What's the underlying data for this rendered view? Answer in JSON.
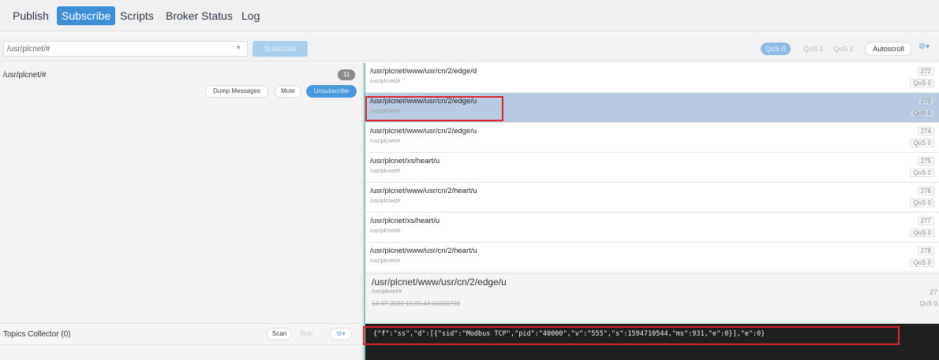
{
  "nav": {
    "tabs": [
      {
        "label": "Publish",
        "active": false
      },
      {
        "label": "Subscribe",
        "active": true
      },
      {
        "label": "Scripts",
        "active": false
      },
      {
        "label": "Broker Status",
        "active": false
      },
      {
        "label": "Log",
        "active": false
      }
    ]
  },
  "subscribe_bar": {
    "topic_value": "/usr/plcnet/#",
    "subscribe_label": "Subscribe",
    "qos_options": [
      {
        "label": "QoS 0",
        "selected": true
      },
      {
        "label": "QoS 1",
        "selected": false
      },
      {
        "label": "QoS 2",
        "selected": false
      }
    ],
    "autoscroll_label": "Autoscroll",
    "settings_glyph": "⚙▾"
  },
  "subscriptions": {
    "items": [
      {
        "topic": "/usr/plcnet/#",
        "count": "11"
      }
    ],
    "dump_label": "Dump Messages",
    "mute_label": "Mute",
    "unsubscribe_label": "Unsubscribe"
  },
  "topics_collector": {
    "label": "Topics Collector (0)",
    "scan_label": "Scan",
    "stop_label": "Stop",
    "settings_glyph": "⚙▾"
  },
  "messages": [
    {
      "topic": "/usr/plcnet/www/usr/cn/2/edge/d",
      "subscription": "/usr/plcnet/#",
      "num": "272",
      "qos": "QoS 0",
      "selected": false
    },
    {
      "topic": "/usr/plcnet/www/usr/cn/2/edge/u",
      "subscription": "/usr/plcnet/#",
      "num": "273",
      "qos": "QoS 0",
      "selected": true
    },
    {
      "topic": "/usr/plcnet/www/usr/cn/2/edge/u",
      "subscription": "/usr/plcnet/#",
      "num": "274",
      "qos": "QoS 0",
      "selected": false
    },
    {
      "topic": "/usr/plcnet/xs/heart/u",
      "subscription": "/usr/plcnet/#",
      "num": "275",
      "qos": "QoS 0",
      "selected": false
    },
    {
      "topic": "/usr/plcnet/www/usr/cn/2/heart/u",
      "subscription": "/usr/plcnet/#",
      "num": "276",
      "qos": "QoS 0",
      "selected": false
    },
    {
      "topic": "/usr/plcnet/xs/heart/u",
      "subscription": "/usr/plcnet/#",
      "num": "277",
      "qos": "QoS 0",
      "selected": false
    },
    {
      "topic": "/usr/plcnet/www/usr/cn/2/heart/u",
      "subscription": "/usr/plcnet/#",
      "num": "278",
      "qos": "QoS 0",
      "selected": false
    }
  ],
  "detail": {
    "topic": "/usr/plcnet/www/usr/cn/2/edge/u",
    "subscription": "/usr/plcnet/#",
    "timestamp": "14-07-2020 15:05:44.04310793",
    "num": "27",
    "qos": "QoS 0"
  },
  "payload": {
    "text": "{\"f\":\"ss\",\"d\":[{\"sid\":\"Modbus TCP\",\"pid\":\"40000\",\"v\":\"555\",\"s\":1594710544,\"ms\":931,\"e\":0}],\"e\":0}"
  },
  "colors": {
    "accent": "#3f8fd6",
    "selected_row": "#b9cbe2",
    "highlight": "#d9242b",
    "payload_bg": "#1f1f1f"
  }
}
